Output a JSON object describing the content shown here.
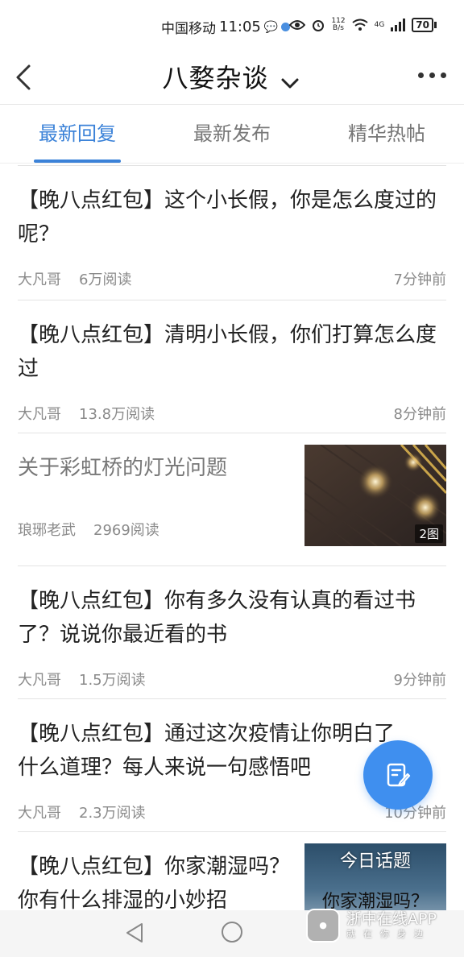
{
  "status_bar": {
    "carrier": "中国移动",
    "time": "11:05",
    "net_speed_value": "112",
    "net_speed_unit": "B/s",
    "signal_label": "4G",
    "battery": "70"
  },
  "header": {
    "title": "八婺杂谈"
  },
  "tabs": [
    {
      "label": "最新回复",
      "active": true
    },
    {
      "label": "最新发布",
      "active": false
    },
    {
      "label": "精华热帖",
      "active": false
    }
  ],
  "posts": [
    {
      "title": "【晚八点红包】这个小长假，你是怎么度过的呢？",
      "author": "大凡哥",
      "reads": "6万阅读",
      "time": "7分钟前"
    },
    {
      "title": "【晚八点红包】清明小长假，你们打算怎么度过",
      "author": "大凡哥",
      "reads": "13.8万阅读",
      "time": "8分钟前"
    },
    {
      "title": "关于彩虹桥的灯光问题",
      "author": "琅琊老武",
      "reads": "2969阅读",
      "time": "",
      "image_count": "2图"
    },
    {
      "title": "【晚八点红包】你有多久没有认真的看过书了？说说你最近看的书",
      "author": "大凡哥",
      "reads": "1.5万阅读",
      "time": "9分钟前"
    },
    {
      "title": "【晚八点红包】通过这次疫情让你明白了什么道理？每人来说一句感悟吧",
      "author": "大凡哥",
      "reads": "2.3万阅读",
      "time": "10分钟前"
    },
    {
      "title": "【晚八点红包】你家潮湿吗？你有什么排湿的小妙招",
      "thumb_caption_top": "今日话题",
      "thumb_caption_bottom": "你家潮湿吗？"
    }
  ],
  "watermark": {
    "name": "浙中在线APP",
    "slogan": "就在你身边"
  },
  "colors": {
    "accent": "#3b82d8",
    "fab": "#3f8fef"
  }
}
